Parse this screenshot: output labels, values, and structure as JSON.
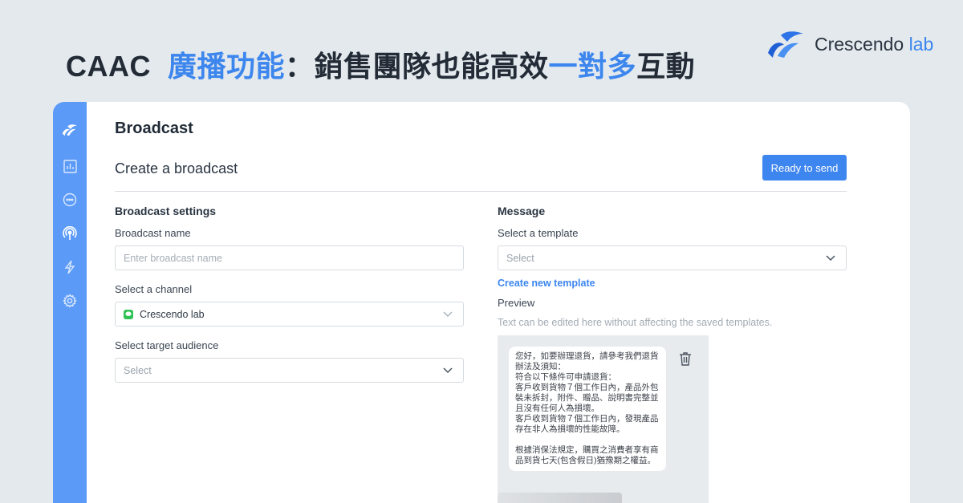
{
  "headline": {
    "part1": "CAAC",
    "accent1": "廣播功能",
    "part2": "：銷售團隊也能高效",
    "accent2": "一對多",
    "part3": "互動"
  },
  "brand": {
    "name": "Crescendo",
    "suffix": " lab"
  },
  "colors": {
    "accent": "#3c86ee",
    "sidebar": "#5b9bf7",
    "button": "#3e86ef",
    "line_green": "#2fc255"
  },
  "sidebar": {
    "items": [
      {
        "icon": "logo-icon"
      },
      {
        "icon": "chart-icon"
      },
      {
        "icon": "chat-icon"
      },
      {
        "icon": "broadcast-icon"
      },
      {
        "icon": "lightning-icon"
      },
      {
        "icon": "gear-icon"
      }
    ]
  },
  "page": {
    "title": "Broadcast",
    "section_title": "Create a broadcast",
    "ready_button": "Ready to send"
  },
  "settings": {
    "title": "Broadcast settings",
    "name_label": "Broadcast name",
    "name_placeholder": "Enter broadcast name",
    "channel_label": "Select a channel",
    "channel_value": "Crescendo lab",
    "audience_label": "Select target audience",
    "audience_placeholder": "Select"
  },
  "message": {
    "title": "Message",
    "template_label": "Select a template",
    "template_placeholder": "Select",
    "create_link": "Create new template",
    "preview_label": "Preview",
    "preview_hint": "Text can be edited here without affecting the saved templates.",
    "bubble_lines": [
      "您好，如要辦理退貨，請參考我們退貨",
      "辦法及須知：",
      "符合以下條件可申請退貨：",
      "客戶收到貨物７個工作日內，產品外包",
      "裝未拆封，附件、贈品、說明書完整並",
      "且沒有任何人為損壞。",
      "客戶收到貨物７個工作日內，發現產品",
      "存在非人為損壞的性能故障。",
      "",
      "根據消保法規定，購買之消費者享有商",
      "品到貨七天(包含假日)猶豫期之權益。"
    ]
  }
}
